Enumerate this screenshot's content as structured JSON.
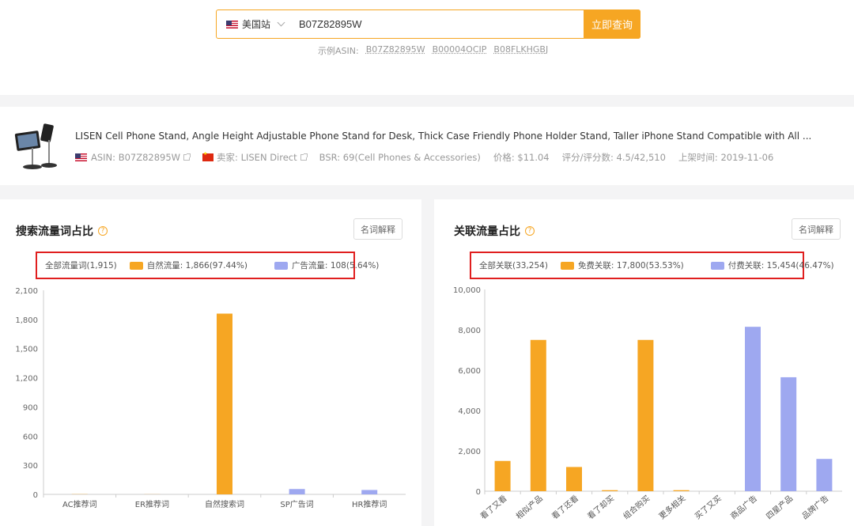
{
  "search": {
    "site": "美国站",
    "query": "B07Z82895W",
    "button": "立即查询",
    "examples_label": "示例ASIN:",
    "examples": [
      "B07Z82895W",
      "B00004OCIP",
      "B08FLKHGBJ"
    ]
  },
  "product": {
    "title": "LISEN Cell Phone Stand, Angle Height Adjustable Phone Stand for Desk, Thick Case Friendly Phone Holder Stand, Taller iPhone Stand Compatible with All ...",
    "asin": "ASIN: B07Z82895W",
    "seller": "卖家: LISEN Direct",
    "bsr": "BSR: 69(Cell Phones & Accessories)",
    "price": "价格: $11.04",
    "rating": "评分/评分数: 4.5/42,510",
    "listed": "上架时间: 2019-11-06"
  },
  "colors": {
    "accent": "#f6a623",
    "organic": "#f6a623",
    "paid": "#9ea8f0",
    "highlight": "#e01f1f"
  },
  "left_panel": {
    "title": "搜索流量词占比",
    "explain": "名词解释",
    "legend": {
      "total": "全部流量词(1,915)",
      "organic": "自然流量: 1,866(97.44%)",
      "ads": "广告流量: 108(5.64%)"
    }
  },
  "right_panel": {
    "title": "关联流量占比",
    "explain": "名词解释",
    "legend": {
      "total": "全部关联(33,254)",
      "free": "免费关联: 17,800(53.53%)",
      "paid": "付费关联: 15,454(46.47%)"
    }
  },
  "chart_data": [
    {
      "type": "bar",
      "categories": [
        "AC推荐词",
        "ER推荐词",
        "自然搜索词",
        "SP广告词",
        "HR推荐词"
      ],
      "values": [
        2,
        1,
        1860,
        55,
        45
      ],
      "colors": [
        "organic",
        "organic",
        "organic",
        "paid",
        "paid"
      ],
      "yticks": [
        "0",
        "300",
        "600",
        "900",
        "1,200",
        "1,500",
        "1,800",
        "2,100"
      ],
      "ylim": [
        0,
        2100
      ]
    },
    {
      "type": "bar",
      "categories": [
        "看了又看",
        "相似产品",
        "看了还看",
        "看了却买",
        "组合购买",
        "更多相关",
        "买了又买",
        "商品广告",
        "四星产品",
        "品牌广告"
      ],
      "values": [
        1500,
        7500,
        1200,
        50,
        7500,
        50,
        0,
        8150,
        5650,
        1600
      ],
      "colors": [
        "organic",
        "organic",
        "organic",
        "organic",
        "organic",
        "organic",
        "organic",
        "paid",
        "paid",
        "paid"
      ],
      "yticks": [
        "0",
        "2,000",
        "4,000",
        "6,000",
        "8,000",
        "10,000"
      ],
      "ylim": [
        0,
        10000
      ]
    }
  ]
}
